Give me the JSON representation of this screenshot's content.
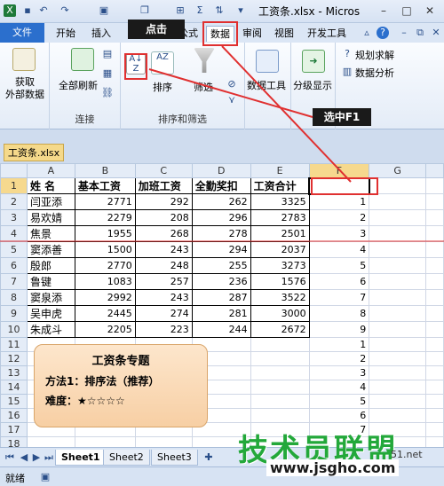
{
  "window": {
    "title": "工资条.xlsx - Micros"
  },
  "tabs": [
    "开始",
    "插入",
    "公式",
    "数据",
    "审阅",
    "视图",
    "开发工具"
  ],
  "file_tab": "文件",
  "ribbon": {
    "get_external": "获取\n外部数据",
    "refresh_all": "全部刷新",
    "group_conn": "连接",
    "sort": "排序",
    "filter": "筛选",
    "group_sort": "排序和筛选",
    "data_tools": "数据工具",
    "outline": "分级显示",
    "solver": "规划求解",
    "analysis": "数据分析"
  },
  "annotations": {
    "click": "点击",
    "select": "选中F1"
  },
  "workbook_tab": "工资条.xlsx",
  "columns": [
    "A",
    "B",
    "C",
    "D",
    "E",
    "F",
    "G"
  ],
  "headers": [
    "姓 名",
    "基本工资",
    "加班工资",
    "全勤奖扣",
    "工资合计"
  ],
  "rows": [
    [
      "闫亚添",
      "2771",
      "292",
      "262",
      "3325",
      "1"
    ],
    [
      "易欢婧",
      "2279",
      "208",
      "296",
      "2783",
      "2"
    ],
    [
      "焦景",
      "1955",
      "268",
      "278",
      "2501",
      "3"
    ],
    [
      "窦添善",
      "1500",
      "243",
      "294",
      "2037",
      "4"
    ],
    [
      "殷郎",
      "2770",
      "248",
      "255",
      "3273",
      "5"
    ],
    [
      "鲁键",
      "1083",
      "257",
      "236",
      "1576",
      "6"
    ],
    [
      "窦泉添",
      "2992",
      "243",
      "287",
      "3522",
      "7"
    ],
    [
      "吴申虎",
      "2445",
      "274",
      "281",
      "3000",
      "8"
    ],
    [
      "朱成斗",
      "2205",
      "223",
      "244",
      "2672",
      "9"
    ]
  ],
  "extra_f": [
    "1",
    "2",
    "3",
    "4",
    "5",
    "6",
    "7"
  ],
  "card": {
    "title": "工资条专题",
    "method": "方法1：排序法（推荐）",
    "difficulty": "难度：★☆☆☆☆"
  },
  "sheets": [
    "Sheet1",
    "Sheet2",
    "Sheet3"
  ],
  "status": "就绪",
  "watermark": {
    "text": "技术员联盟",
    "url": "www.jsgho.com",
    "partial": "51.net"
  }
}
